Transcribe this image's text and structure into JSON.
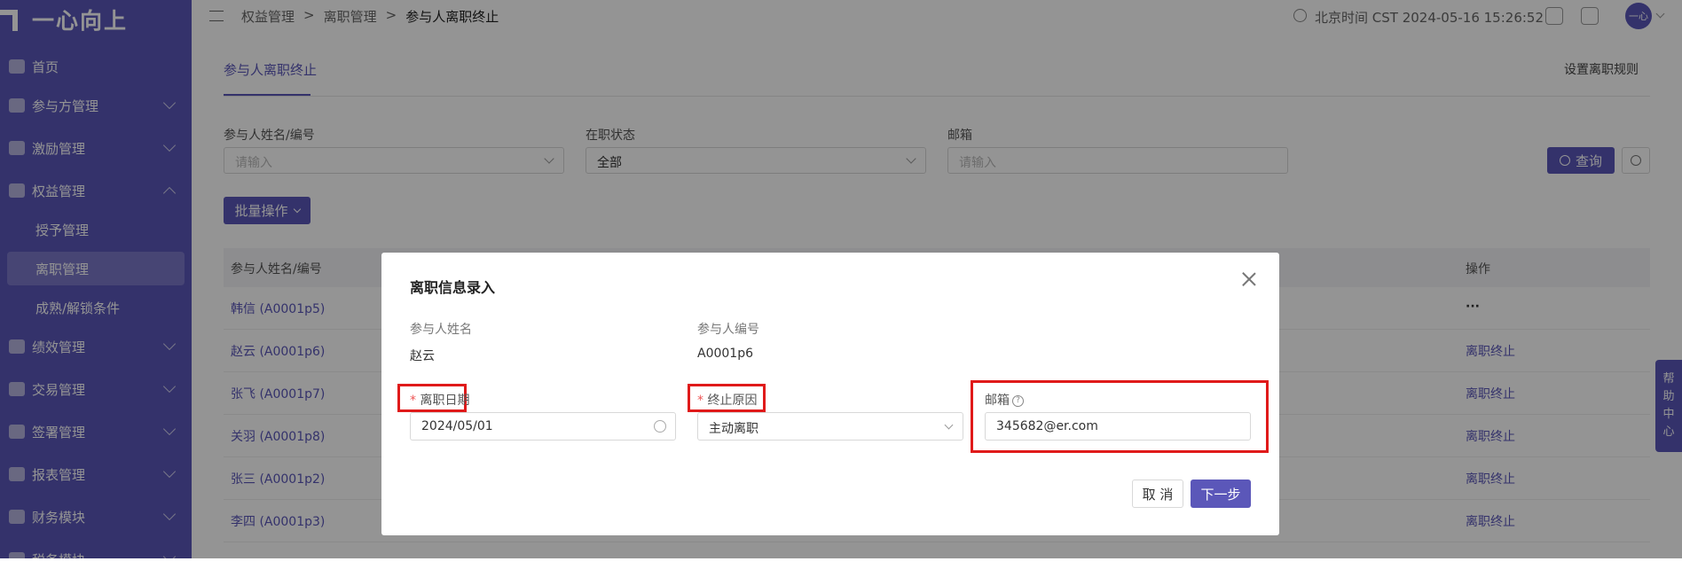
{
  "app": {
    "name": "一心向上"
  },
  "sidebar": {
    "items": [
      {
        "label": "首页"
      },
      {
        "label": "参与方管理"
      },
      {
        "label": "激励管理"
      },
      {
        "label": "权益管理"
      },
      {
        "label": "授予管理"
      },
      {
        "label": "离职管理"
      },
      {
        "label": "成熟/解锁条件"
      },
      {
        "label": "绩效管理"
      },
      {
        "label": "交易管理"
      },
      {
        "label": "签署管理"
      },
      {
        "label": "报表管理"
      },
      {
        "label": "财务模块"
      },
      {
        "label": "税务模块"
      }
    ]
  },
  "header": {
    "breadcrumb": [
      "权益管理",
      "离职管理",
      "参与人离职终止"
    ],
    "sep": ">",
    "time": "北京时间 CST 2024-05-16 15:26:52",
    "avatar": "一心"
  },
  "main": {
    "tab": "参与人离职终止",
    "rule_link": "设置离职规则",
    "filters": {
      "name_label": "参与人姓名/编号",
      "name_placeholder": "请输入",
      "status_label": "在职状态",
      "status_value": "全部",
      "email_label": "邮箱",
      "email_placeholder": "请输入"
    },
    "query_btn": "查询",
    "batch_btn": "批量操作",
    "table": {
      "col_name": "参与人姓名/编号",
      "col_op": "操作",
      "rows": [
        {
          "name": "韩信 (A0001p5)",
          "op": "···"
        },
        {
          "name": "赵云 (A0001p6)",
          "op": "离职终止"
        },
        {
          "name": "张飞 (A0001p7)",
          "op": "离职终止"
        },
        {
          "name": "关羽 (A0001p8)",
          "op": "离职终止"
        },
        {
          "name": "张三 (A0001p2)",
          "op": "离职终止"
        },
        {
          "name": "李四 (A0001p3)",
          "op": "离职终止"
        }
      ]
    }
  },
  "help": [
    "帮",
    "助",
    "中",
    "心"
  ],
  "modal": {
    "title": "离职信息录入",
    "name_label": "参与人姓名",
    "name_value": "赵云",
    "id_label": "参与人编号",
    "id_value": "A0001p6",
    "date_label": "离职日期",
    "date_value": "2024/05/01",
    "reason_label": "终止原因",
    "reason_value": "主动离职",
    "email_label": "邮箱",
    "email_value": "345682@er.com",
    "required_mark": "*",
    "cancel": "取 消",
    "next": "下一步"
  }
}
